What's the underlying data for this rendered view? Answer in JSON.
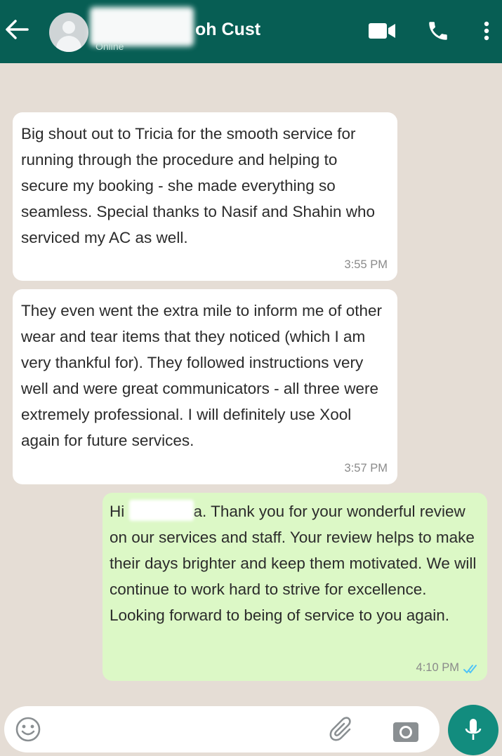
{
  "header": {
    "contact_name": "oh Cust",
    "status": "Online",
    "back_icon": "arrow-left-icon",
    "video_icon": "video-camera-icon",
    "call_icon": "phone-icon",
    "menu_icon": "more-vertical-icon",
    "color": "#075e54"
  },
  "messages": [
    {
      "direction": "incoming",
      "text": "Big shout out to Tricia for the smooth service for running through the procedure and helping to secure my booking - she made everything so seamless. Special thanks to Nasif and Shahin who serviced my AC as well.",
      "time": "3:55 PM"
    },
    {
      "direction": "incoming",
      "text": "They even went the extra mile to inform me of other wear and tear items that they noticed (which I am very thankful for). They followed instructions very well and were great communicators - all three were extremely professional. I will definitely use Xool again for future services.",
      "time": "3:57 PM"
    },
    {
      "direction": "outgoing",
      "greeting": "Hi",
      "text": "a. Thank you for your wonderful review on our services and staff. Your review helps to make their days brighter and keep them motivated. We will continue to work hard to strive for excellence. Looking forward to being of service to you again.",
      "time": "4:10 PM",
      "read_receipt": "double-check-icon",
      "bubble_color": "#dcf8c6"
    }
  ],
  "input_bar": {
    "emoji_icon": "emoji-icon",
    "attach_icon": "paperclip-icon",
    "camera_icon": "camera-icon",
    "mic_icon": "microphone-icon",
    "mic_color": "#128c7e"
  }
}
